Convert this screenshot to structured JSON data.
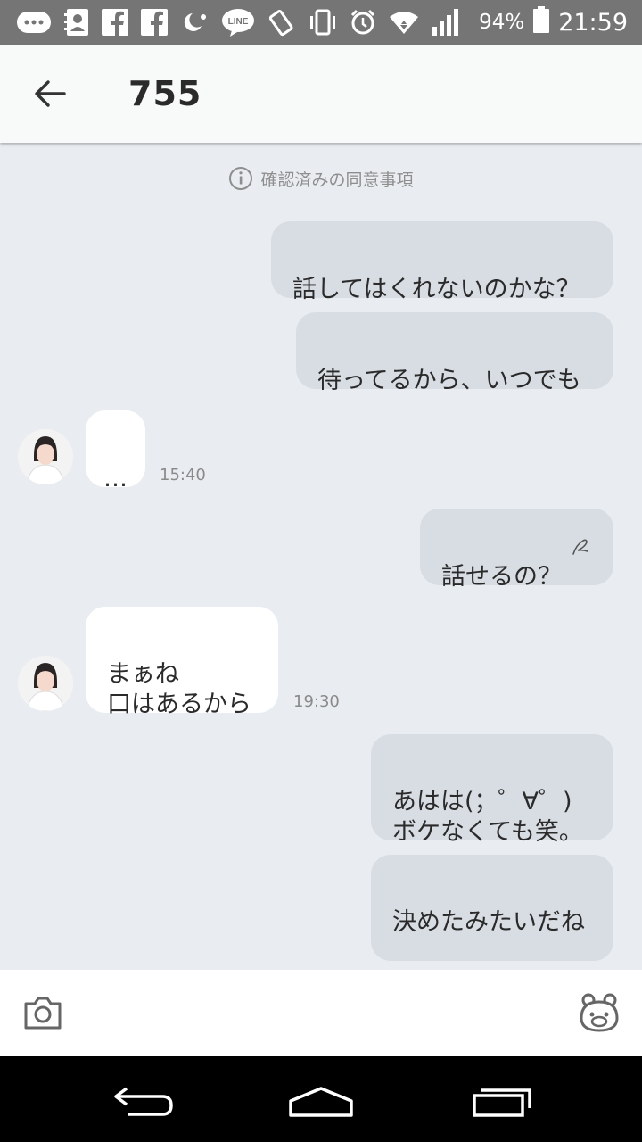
{
  "status_bar": {
    "battery_percent": "94%",
    "time": "21:59",
    "icons": [
      "more-icon",
      "contacts-icon",
      "facebook-icon",
      "facebook-icon",
      "night-icon",
      "line-icon",
      "rotate-icon",
      "vibrate-icon",
      "alarm-icon",
      "wifi-icon",
      "signal-icon",
      "battery-icon"
    ],
    "line_text": "LINE"
  },
  "header": {
    "title": "755"
  },
  "notice": {
    "text": "確認済みの同意事項"
  },
  "messages": [
    {
      "side": "out",
      "text": "話してはくれないのかな？"
    },
    {
      "side": "out",
      "text": "待ってるから、いつでも"
    },
    {
      "side": "in",
      "text": "…",
      "time": "15:40"
    },
    {
      "side": "out",
      "text": "話せるの？"
    },
    {
      "side": "in",
      "text": "まぁね\n口はあるから",
      "time": "19:30"
    },
    {
      "side": "out",
      "text": "あはは(；゜∀゜)\nボケなくても笑。"
    },
    {
      "side": "out",
      "text": "決めたみたいだね"
    }
  ],
  "colors": {
    "background": "#e9edf1",
    "outgoing_bubble": "#d8dde4",
    "incoming_bubble": "#ffffff",
    "status_bar": "#757575"
  }
}
